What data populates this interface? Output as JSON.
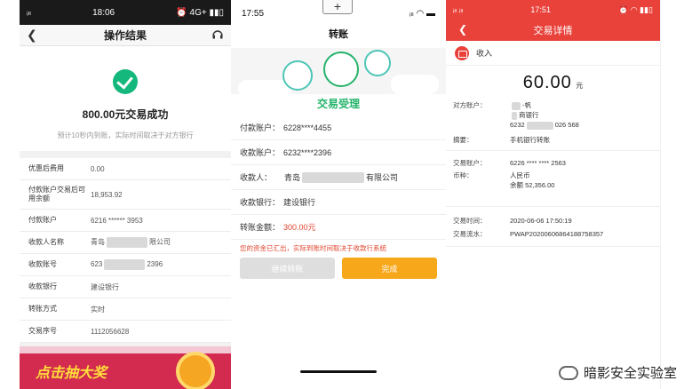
{
  "p1": {
    "status": {
      "signal": "ᵢₗₗ",
      "time": "18:06",
      "icons": "⏰ 4G+ ▮▮▯"
    },
    "title": "操作结果",
    "amount_text": "800.00元交易成功",
    "tip": "预计10秒内到账，实际时间取决于对方银行",
    "rows": [
      {
        "label": "优惠后费用",
        "value": "0.00"
      },
      {
        "label": "付款账户交易后可用余额",
        "value": "18,953.92"
      },
      {
        "label": "付款账户",
        "value": "6216 ****** 3953"
      },
      {
        "label": "收款人名称",
        "value_pre": "青岛",
        "value_post": "限公司"
      },
      {
        "label": "收款账号",
        "value_pre": "623",
        "value_post": "2396"
      },
      {
        "label": "收款银行",
        "value": "建设银行"
      },
      {
        "label": "转账方式",
        "value": "实时"
      },
      {
        "label": "交易序号",
        "value": "1112056628"
      }
    ],
    "banner_text": "点击抽大奖"
  },
  "p2": {
    "status": {
      "time": "17:55",
      "icons": "ᵢₗₗ ◠ ▬"
    },
    "plus_label": "+",
    "title": "转账",
    "illus_title": "交易受理",
    "fields": [
      {
        "label": "付款账户：",
        "value": "6228****4455"
      },
      {
        "label": "收款账户：",
        "value": "6232****2396"
      },
      {
        "label": "收款人：",
        "value_pre": "青岛",
        "value_post": "有限公司"
      },
      {
        "label": "收款银行：",
        "value": "建设银行"
      },
      {
        "label": "转账金额：",
        "value": "300.00元"
      }
    ],
    "warning": "您的资金已汇出，实际到账时间取决于收款行系统",
    "buttons": {
      "continue": "继续转账",
      "done": "完成"
    }
  },
  "p3": {
    "status": {
      "signal": "ᵢₗₗ ᵢₗₗ",
      "time": "17:51",
      "icons": "⏰ ◠ ▮▮▯"
    },
    "title": "交易详情",
    "category": "收入",
    "amount": "60.00",
    "unit": "元",
    "counterparty": {
      "label": "对方账户：",
      "line1": "-帆",
      "line2": "商银行",
      "line3_pre": "6232",
      "line3_post": "026 568"
    },
    "summary": {
      "label": "摘要：",
      "value": "手机银行转账"
    },
    "account": {
      "label": "交易账户：",
      "value": "6226 **** **** 2563"
    },
    "currency": {
      "label": "币种：",
      "value": "人民币",
      "balance": "余额 52,356.00"
    },
    "time": {
      "label": "交易时间：",
      "value": "2020-06-06 17:50:19"
    },
    "serial": {
      "label": "交易流水：",
      "value": "PWAP20200606864188758357"
    }
  },
  "watermark": "暗影安全实验室",
  "colors": {
    "green": "#14b87c",
    "red_header": "#e9423b",
    "orange": "#f6a71a",
    "teal": "#4dc6b6"
  }
}
